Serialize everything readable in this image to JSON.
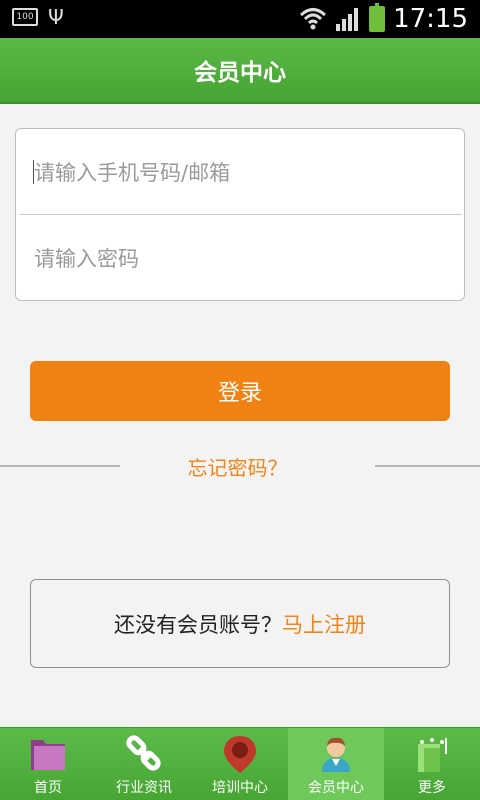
{
  "status_bar": {
    "battery_small": "100",
    "time": "17:15"
  },
  "header": {
    "title": "会员中心"
  },
  "form": {
    "phone_placeholder": "请输入手机号码/邮箱",
    "password_placeholder": "请输入密码"
  },
  "login_button": "登录",
  "forgot_password": "忘记密码？",
  "register": {
    "prompt": "还没有会员账号？",
    "link": "马上注册"
  },
  "tabs": [
    {
      "label": "首页",
      "icon": "folder-icon"
    },
    {
      "label": "行业资讯",
      "icon": "link-icon"
    },
    {
      "label": "培训中心",
      "icon": "location-pin-icon"
    },
    {
      "label": "会员中心",
      "icon": "user-icon",
      "active": true
    },
    {
      "label": "更多",
      "icon": "more-icon"
    }
  ],
  "colors": {
    "green": "#4caf36",
    "orange": "#f08214"
  }
}
